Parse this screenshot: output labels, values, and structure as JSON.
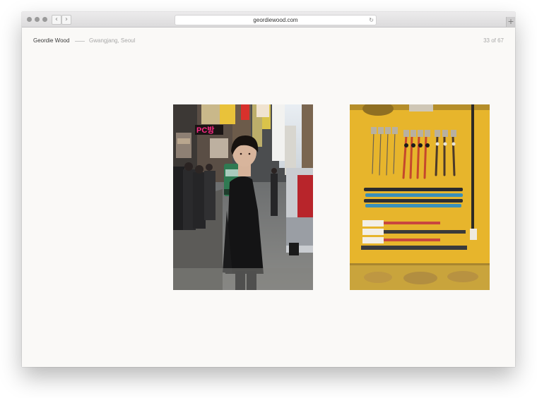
{
  "browser": {
    "address": "geordiewood.com",
    "back_glyph": "‹",
    "forward_glyph": "›",
    "reload_glyph": "↻",
    "new_tab_glyph": "+"
  },
  "header": {
    "site_name": "Geordie Wood",
    "location": "Gwangjang, Seoul",
    "counter": "33 of 67"
  },
  "gallery": {
    "images": [
      {
        "subject": "street-portrait"
      },
      {
        "subject": "cables-on-yellow"
      }
    ]
  },
  "photo_signage": [
    "PC방"
  ],
  "colors": {
    "page_background": "#faf9f7",
    "cable_panel_yellow": "#e7b52c",
    "street_sign_pink": "#ff2a86"
  },
  "icons": [
    "back-chevron-icon",
    "forward-chevron-icon",
    "reload-icon",
    "plus-icon"
  ]
}
